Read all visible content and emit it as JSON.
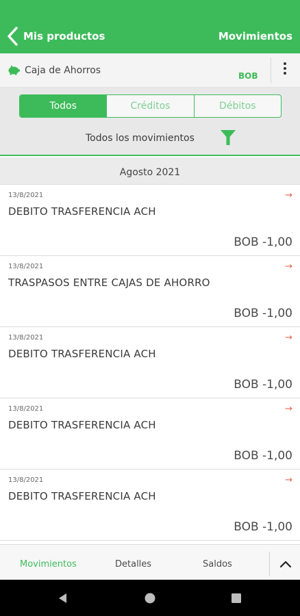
{
  "header": {
    "back_label": "Mis productos",
    "title": "Movimientos",
    "color": "#3dbb5a"
  },
  "account": {
    "name": "Caja de Ahorros",
    "currency": "BOB",
    "icon": "piggy-bank-icon"
  },
  "filters": {
    "segments": [
      {
        "label": "Todos",
        "active": true
      },
      {
        "label": "Créditos",
        "active": false
      },
      {
        "label": "Débitos",
        "active": false
      }
    ],
    "filter_text": "Todos los movimientos",
    "filter_icon": "funnel-icon"
  },
  "month_header": "Agosto 2021",
  "transactions": [
    {
      "date": "13/8/2021",
      "description": "DEBITO TRASFERENCIA ACH",
      "amount": "BOB -1,00"
    },
    {
      "date": "13/8/2021",
      "description": "TRASPASOS ENTRE CAJAS DE AHORRO",
      "amount": "BOB -1,00"
    },
    {
      "date": "13/8/2021",
      "description": "DEBITO TRASFERENCIA ACH",
      "amount": "BOB -1,00"
    },
    {
      "date": "13/8/2021",
      "description": "DEBITO TRASFERENCIA ACH",
      "amount": "BOB -1,00"
    },
    {
      "date": "13/8/2021",
      "description": "DEBITO TRASFERENCIA ACH",
      "amount": "BOB -1,00"
    }
  ],
  "bottom_tabs": [
    {
      "label": "Movimientos",
      "active": true
    },
    {
      "label": "Detalles",
      "active": false
    },
    {
      "label": "Saldos",
      "active": false
    }
  ],
  "arrow_glyph": "→"
}
